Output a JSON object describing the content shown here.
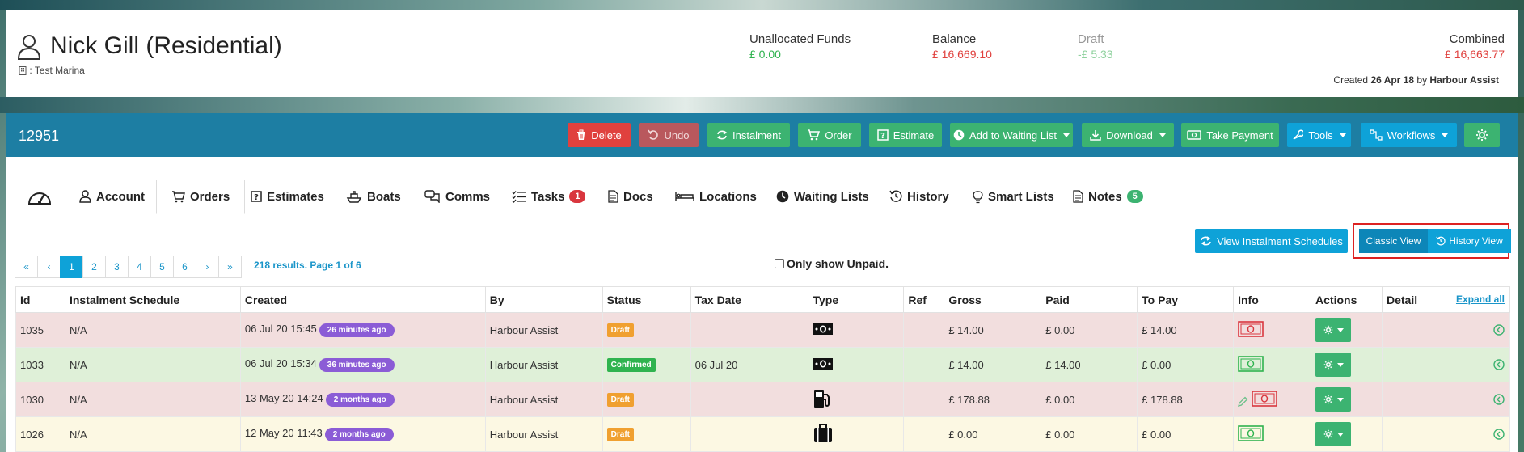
{
  "header": {
    "name": "Nick Gill (Residential)",
    "marina": ": Test Marina",
    "stats": [
      {
        "label": "Unallocated Funds",
        "value": "£ 0.00",
        "color": "#2fb34f"
      },
      {
        "label": "Balance",
        "value": "£ 16,669.10",
        "color": "#e0413e"
      },
      {
        "label": "Draft",
        "value": "-£ 5.33",
        "color": "#8fd19e"
      },
      {
        "label": "Combined",
        "value": "£ 16,663.77",
        "color": "#e0413e"
      }
    ],
    "created_prefix": "Created",
    "created_date": "26 Apr 18",
    "created_by_prefix": "by",
    "created_by": "Harbour Assist"
  },
  "toolbar": {
    "record_id": "12951",
    "delete": "Delete",
    "undo": "Undo",
    "instalment": "Instalment",
    "order": "Order",
    "estimate": "Estimate",
    "waiting_list": "Add to Waiting List",
    "download": "Download",
    "take_payment": "Take Payment",
    "tools": "Tools",
    "workflows": "Workflows"
  },
  "tabs": {
    "dashboard_icon": "dashboard-gauge-icon",
    "account": "Account",
    "orders": "Orders",
    "estimates": "Estimates",
    "boats": "Boats",
    "comms": "Comms",
    "tasks": "Tasks",
    "tasks_badge": "1",
    "docs": "Docs",
    "locations": "Locations",
    "waiting_lists": "Waiting Lists",
    "history": "History",
    "smart_lists": "Smart Lists",
    "notes": "Notes",
    "notes_badge": "5"
  },
  "controls": {
    "view_instalment": "View Instalment Schedules",
    "classic_view": "Classic View",
    "history_view": "History View",
    "only_unpaid": "Only show Unpaid.",
    "pager": [
      "«",
      "‹",
      "1",
      "2",
      "3",
      "4",
      "5",
      "6",
      "›",
      "»"
    ],
    "results": "218 results. Page 1 of 6"
  },
  "table": {
    "columns": [
      "Id",
      "Instalment Schedule",
      "Created",
      "By",
      "Status",
      "Tax Date",
      "Type",
      "Ref",
      "Gross",
      "Paid",
      "To Pay",
      "Info",
      "Actions",
      "Detail"
    ],
    "expand_all": "Expand all",
    "rows": [
      {
        "id": "1035",
        "schedule": "N/A",
        "created": "06 Jul 20 15:45",
        "ago": "26 minutes ago",
        "by": "Harbour Assist",
        "status": "Draft",
        "tax_date": "",
        "type_icon": "cash-icon",
        "ref": "",
        "gross": "£ 14.00",
        "paid": "£ 0.00",
        "to_pay": "£ 14.00",
        "info_icon": "unpaid-banknote-icon"
      },
      {
        "id": "1033",
        "schedule": "N/A",
        "created": "06 Jul 20 15:34",
        "ago": "36 minutes ago",
        "by": "Harbour Assist",
        "status": "Confirmed",
        "tax_date": "06 Jul 20",
        "type_icon": "cash-icon",
        "ref": "",
        "gross": "£ 14.00",
        "paid": "£ 14.00",
        "to_pay": "£ 0.00",
        "info_icon": "paid-banknote-icon"
      },
      {
        "id": "1030",
        "schedule": "N/A",
        "created": "13 May 20 14:24",
        "ago": "2 months ago",
        "by": "Harbour Assist",
        "status": "Draft",
        "tax_date": "",
        "type_icon": "fuel-pump-icon",
        "ref": "",
        "gross": "£ 178.88",
        "paid": "£ 0.00",
        "to_pay": "£ 178.88",
        "info_icon": "unpaid-banknote-icon"
      },
      {
        "id": "1026",
        "schedule": "N/A",
        "created": "12 May 20 11:43",
        "ago": "2 months ago",
        "by": "Harbour Assist",
        "status": "Draft",
        "tax_date": "",
        "type_icon": "luggage-icon",
        "ref": "",
        "gross": "£ 0.00",
        "paid": "£ 0.00",
        "to_pay": "£ 0.00",
        "info_icon": "paid-banknote-icon"
      }
    ]
  }
}
